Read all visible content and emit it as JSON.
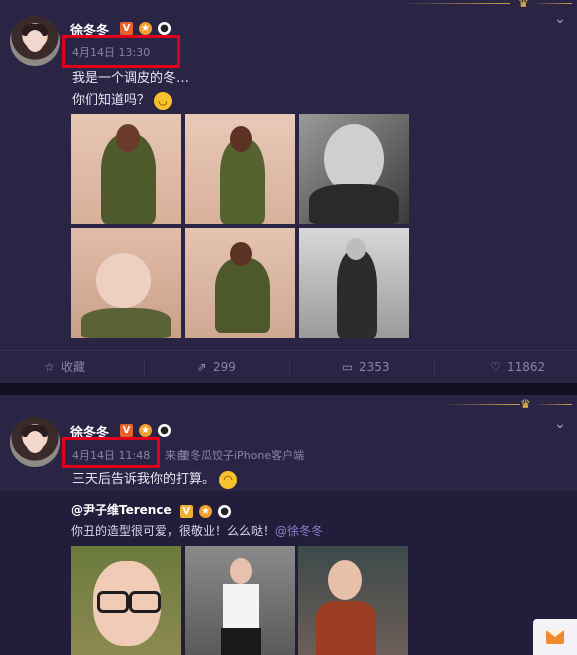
{
  "colors": {
    "page_bg": "#1c1830",
    "card_bg": "#2a2445",
    "highlight_box": "#e0001b",
    "muted_text": "#8a85a8",
    "verified_badge": "#e8622c",
    "mention": "#8a7fd0"
  },
  "post1": {
    "username": "徐冬冬",
    "badges": {
      "verified": "V",
      "medal_icon": "medal-icon",
      "panda_icon": "panda-icon"
    },
    "time": "4月14日 13:30",
    "text_line1": "我是一个调皮的冬…",
    "text_line2": "你们知道吗？",
    "photos": [
      "photo-green-suit-1",
      "photo-green-suit-2",
      "photo-bw-portrait-1",
      "photo-lying-portrait",
      "photo-green-suit-3",
      "photo-bw-standing"
    ],
    "actions": {
      "favorite": "收藏",
      "repost_count": "299",
      "comment_count": "2353",
      "like_count": "11862"
    }
  },
  "post2": {
    "username": "徐冬冬",
    "badges": {
      "verified": "V",
      "medal_icon": "medal-icon",
      "panda_icon": "panda-icon"
    },
    "time": "4月14日 11:48",
    "source_prefix": "来自",
    "source": "傻冬瓜饺子iPhone客户端",
    "text": "三天后告诉我你的打算。",
    "repost": {
      "user": "@尹子维Terence",
      "text": "你丑的造型很可爱，很敬业！么么哒！",
      "mention": "@徐冬冬"
    }
  }
}
